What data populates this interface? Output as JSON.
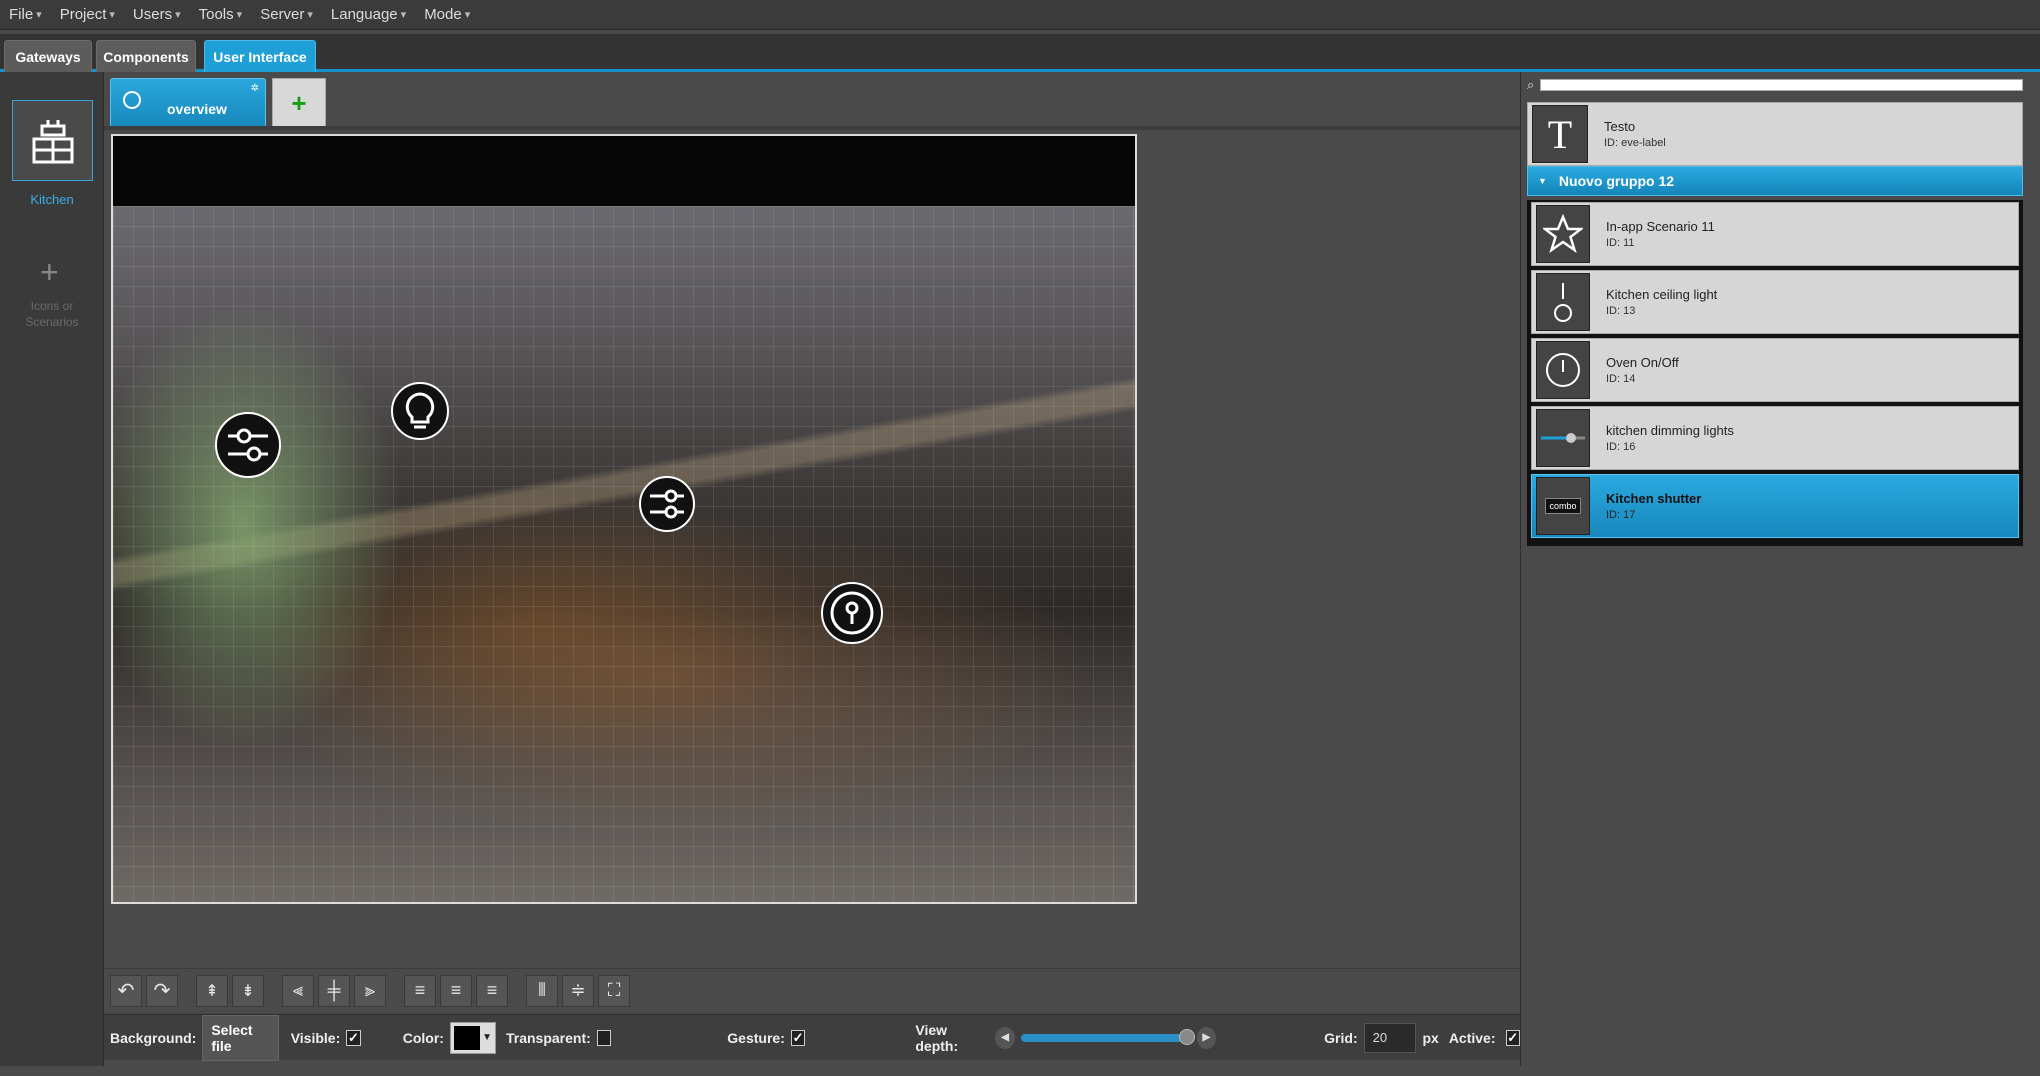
{
  "menu": [
    {
      "label": "File"
    },
    {
      "label": "Project"
    },
    {
      "label": "Users"
    },
    {
      "label": "Tools"
    },
    {
      "label": "Server"
    },
    {
      "label": "Language"
    },
    {
      "label": "Mode"
    }
  ],
  "top_tabs": [
    {
      "label": "Gateways"
    },
    {
      "label": "Components"
    },
    {
      "label": "User Interface",
      "active": true
    }
  ],
  "sidebar": {
    "room_label": "Kitchen",
    "add_label": "Icons or Scenarios"
  },
  "page_tab": {
    "label": "overview"
  },
  "add_page_symbol": "+",
  "toolbar": {
    "background_label": "Background:",
    "select_file_label": "Select file",
    "visible_label": "Visible:",
    "color_label": "Color:",
    "transparent_label": "Transparent:",
    "gesture_label": "Gesture:",
    "view_depth_label": "View depth:",
    "view_depth_value": 0.95,
    "grid_label": "Grid:",
    "grid_value": "20",
    "grid_unit": "px",
    "active_label": "Active:",
    "visible_checked": true,
    "transparent_checked": false,
    "gesture_checked": true,
    "active_checked": true,
    "color_value": "#000000"
  },
  "library": {
    "top_item": {
      "name": "Testo",
      "id": "ID: eve-label",
      "glyph": "T"
    },
    "group": {
      "name": "Nuovo gruppo 12",
      "items": [
        {
          "name": "In-app Scenario 11",
          "id": "ID: 11",
          "icon": "star-icon"
        },
        {
          "name": "Kitchen ceiling light",
          "id": "ID: 13",
          "icon": "switch-icon"
        },
        {
          "name": "Oven On/Off",
          "id": "ID: 14",
          "icon": "power-icon"
        },
        {
          "name": "kitchen dimming lights",
          "id": "ID: 16",
          "icon": "dimmer-icon"
        },
        {
          "name": "Kitchen shutter",
          "id": "ID: 17",
          "icon": "combo-icon",
          "combo_text": "combo",
          "selected": true
        }
      ]
    }
  },
  "colors": {
    "accent": "#1e9fd6",
    "panel": "#4a4a4a",
    "menubar": "#3b3b3b"
  }
}
